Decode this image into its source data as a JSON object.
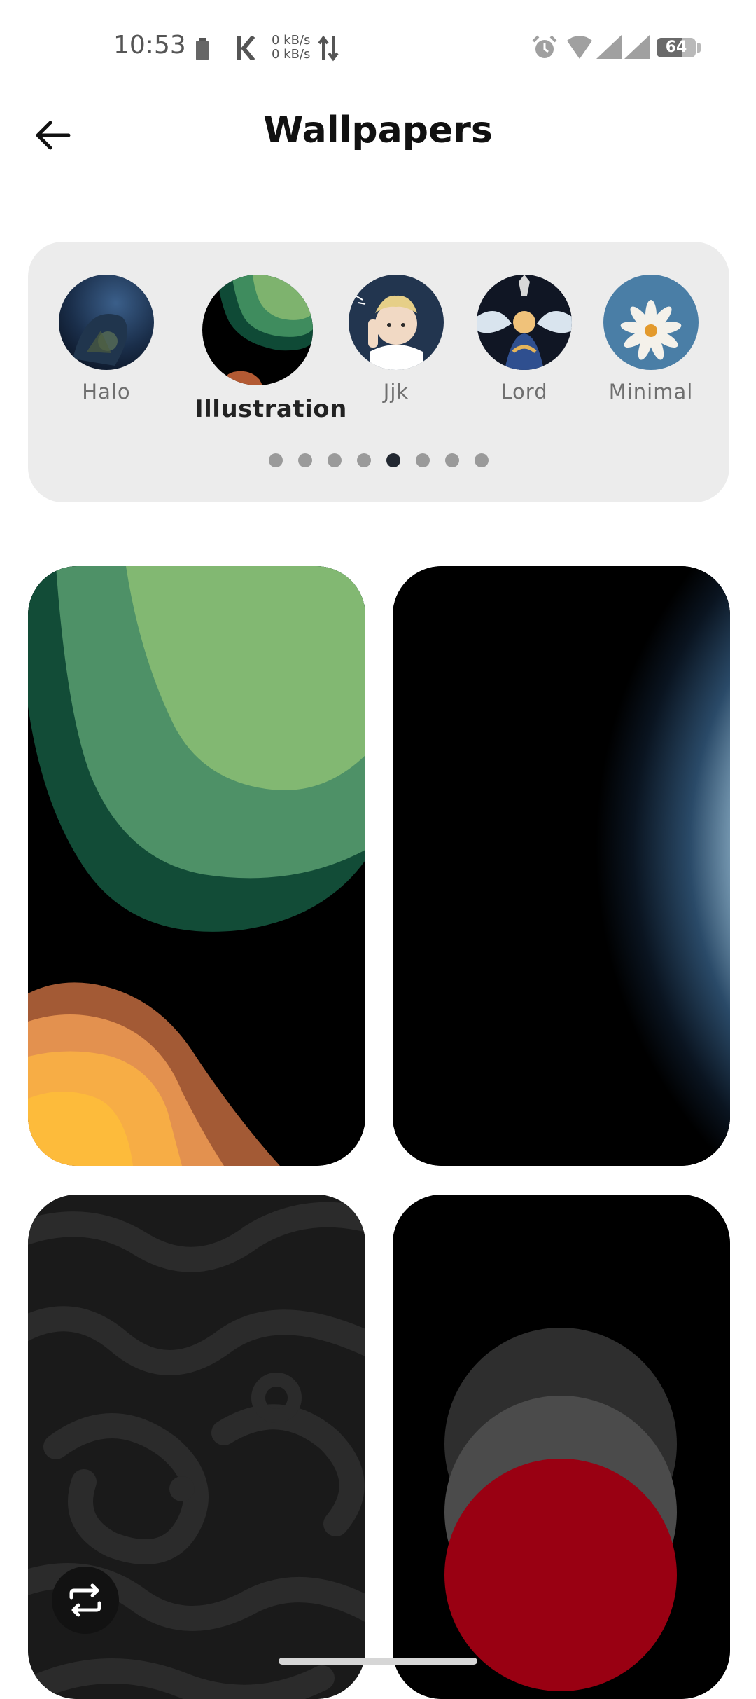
{
  "status_bar": {
    "time": "10:53",
    "net_up": "0 kB/s",
    "net_down": "0 kB/s",
    "battery_level": "64",
    "icons": [
      "battery-saver-icon",
      "k-app-icon",
      "data-arrows-icon",
      "alarm-icon",
      "wifi-icon",
      "signal-icon",
      "signal-icon-2"
    ]
  },
  "header": {
    "title": "Wallpapers",
    "back_icon": "arrow-left-icon"
  },
  "categories": [
    {
      "label": "Halo",
      "active": false
    },
    {
      "label": "Illustration",
      "active": true
    },
    {
      "label": "Jjk",
      "active": false
    },
    {
      "label": "Lord",
      "active": false
    },
    {
      "label": "Minimal",
      "active": false
    }
  ],
  "pager": {
    "total": 8,
    "current_index": 4
  },
  "wallpapers": [
    {
      "name": "green-orange-illustration"
    },
    {
      "name": "blue-ring"
    },
    {
      "name": "dark-topographic"
    },
    {
      "name": "red-grey-circles"
    }
  ],
  "fab": {
    "icon": "repeat-icon"
  },
  "colors": {
    "accent": "#222831",
    "card_bg": "#ececec",
    "active_dot": "#222831"
  }
}
